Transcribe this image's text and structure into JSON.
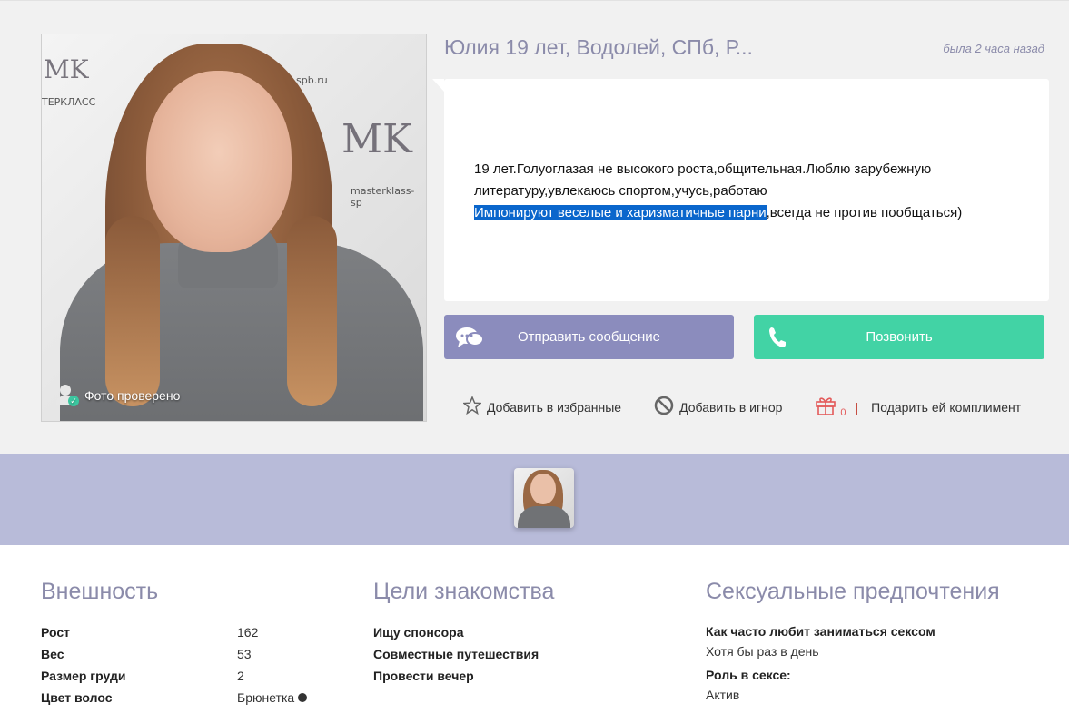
{
  "profile": {
    "name_line": "Юлия 19 лет, Водолей,  СПб, Р...",
    "last_seen": "была 2 часа назад",
    "photo_verified": "Фото проверено",
    "about_line1": "19 лет.Голуоглазая не высокого роста,общительная.Люблю зарубежную литературу,увлекаюсь спортом,учусь,работаю",
    "about_highlight": "Импонируют веселые и харизматичные парни",
    "about_rest": ",всегда не против пообщаться)",
    "photo_wall_text": {
      "logo": "MK",
      "site": "masterklass-sp",
      "left_text": "ТЕРКЛАСС",
      "spb": "spb.ru"
    }
  },
  "buttons": {
    "message": "Отправить сообщение",
    "call": "Позвонить"
  },
  "actions": {
    "favorite": "Добавить в избранные",
    "ignore": "Добавить в игнор",
    "gift_count": "0",
    "compliment": "Подарить ей комплимент",
    "separator": "|"
  },
  "appearance": {
    "title": "Внешность",
    "rows": [
      {
        "label": "Рост",
        "value": "162"
      },
      {
        "label": "Вес",
        "value": "53"
      },
      {
        "label": "Размер груди",
        "value": "2"
      },
      {
        "label": "Цвет волос",
        "value": "Брюнетка"
      }
    ]
  },
  "goals": {
    "title": "Цели знакомства",
    "items": [
      "Ищу спонсора",
      "Совместные путешествия",
      "Провести вечер"
    ]
  },
  "preferences": {
    "title": "Сексуальные предпочтения",
    "items": [
      {
        "label": "Как часто любит заниматься сексом",
        "value": "Хотя бы раз в день"
      },
      {
        "label": "Роль в сексе:",
        "value": "Актив"
      }
    ]
  },
  "colors": {
    "accent_purple": "#8b8cbd",
    "accent_green": "#42d3a5",
    "band": "#b8bbd9",
    "heading": "#8b8baa"
  }
}
